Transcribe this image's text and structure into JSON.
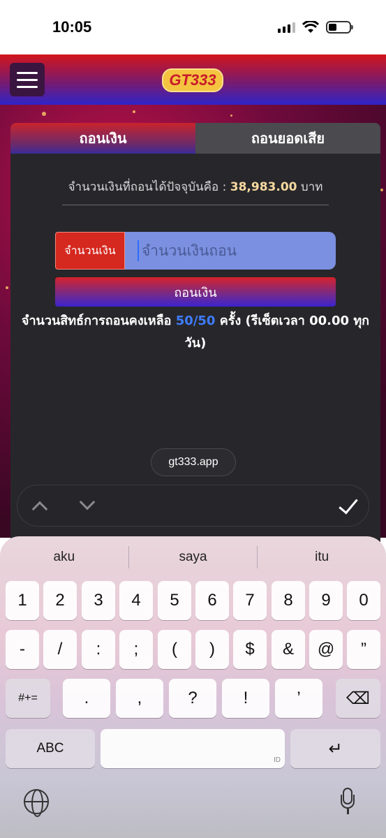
{
  "status_bar": {
    "time": "10:05"
  },
  "header": {
    "logo_text": "GT333"
  },
  "panel": {
    "tabs": [
      {
        "label": "ถอนเงิน",
        "active": true
      },
      {
        "label": "ถอนยอดเสีย",
        "active": false
      }
    ],
    "balance": {
      "prefix": "จำนวนเงินที่ถอนได้ปัจจุบันคือ :",
      "amount": "38,983.00",
      "unit": "บาท"
    },
    "amount_field": {
      "label": "จำนวนเงิน",
      "placeholder": "จำนวนเงินถอน"
    },
    "withdraw_button": "ถอนเงิน",
    "rights": {
      "prefix": "จำนวนสิทธ์การถอนคงเหลือ",
      "count": "50/50",
      "suffix": "ครั้ง (รีเซ็ตเวลา 00.00 ทุกวัน)"
    }
  },
  "browser": {
    "url": "gt333.app"
  },
  "keyboard": {
    "suggestions": [
      "aku",
      "saya",
      "itu"
    ],
    "row1": [
      "1",
      "2",
      "3",
      "4",
      "5",
      "6",
      "7",
      "8",
      "9",
      "0"
    ],
    "row2": [
      "-",
      "/",
      ":",
      ";",
      "(",
      ")",
      "$",
      "&",
      "@",
      "”"
    ],
    "row3": [
      ".",
      ",",
      "?",
      "!",
      "’"
    ],
    "symbols_key": "#+=",
    "abc_key": "ABC",
    "space_hint": "ID",
    "delete_icon": "⌫",
    "return_icon": "↵"
  },
  "colors": {
    "header_top": "#d2161b",
    "header_bottom": "#2f24c8",
    "panel_bg": "#27272b",
    "amount_label_bg": "#d5281f",
    "input_bg": "#7b90e0",
    "rights_count": "#3e7cff"
  }
}
